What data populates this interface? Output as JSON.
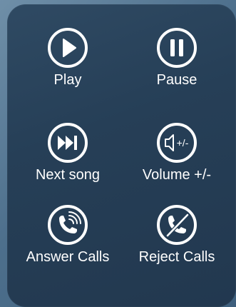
{
  "buttons": {
    "play": {
      "label": "Play",
      "icon": "play-icon"
    },
    "pause": {
      "label": "Pause",
      "icon": "pause-icon"
    },
    "next_song": {
      "label": "Next song",
      "icon": "next-song-icon"
    },
    "volume": {
      "label": "Volume +/-",
      "icon": "volume-icon",
      "icon_text": "+/-"
    },
    "answer_calls": {
      "label": "Answer Calls",
      "icon": "answer-call-icon"
    },
    "reject_calls": {
      "label": "Reject Calls",
      "icon": "reject-call-icon"
    }
  },
  "colors": {
    "panel": "#263f57",
    "background": "#4d6f8c",
    "foreground": "#ffffff"
  }
}
